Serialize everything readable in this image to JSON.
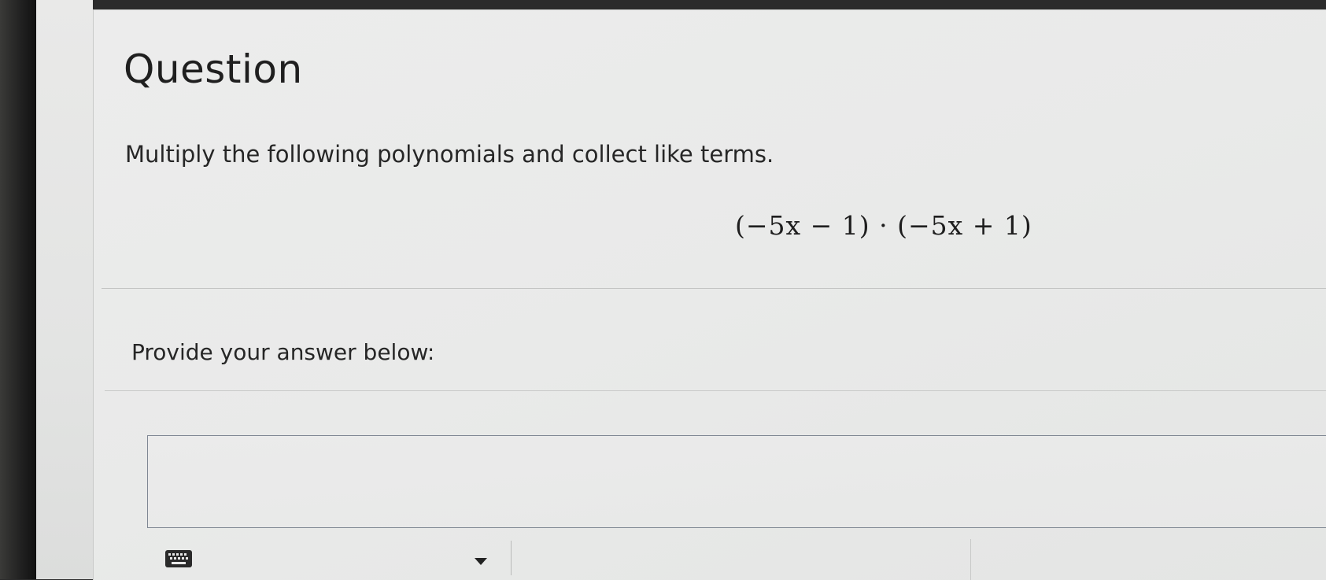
{
  "question": {
    "heading": "Question",
    "instruction": "Multiply the following polynomials and collect like terms.",
    "expression": "(−5x − 1) · (−5x + 1)"
  },
  "answer": {
    "label": "Provide your answer below:",
    "value": "",
    "placeholder": ""
  },
  "toolbar": {
    "keyboard_icon": "keyboard-icon",
    "dropdown_icon": "caret-down-icon"
  }
}
